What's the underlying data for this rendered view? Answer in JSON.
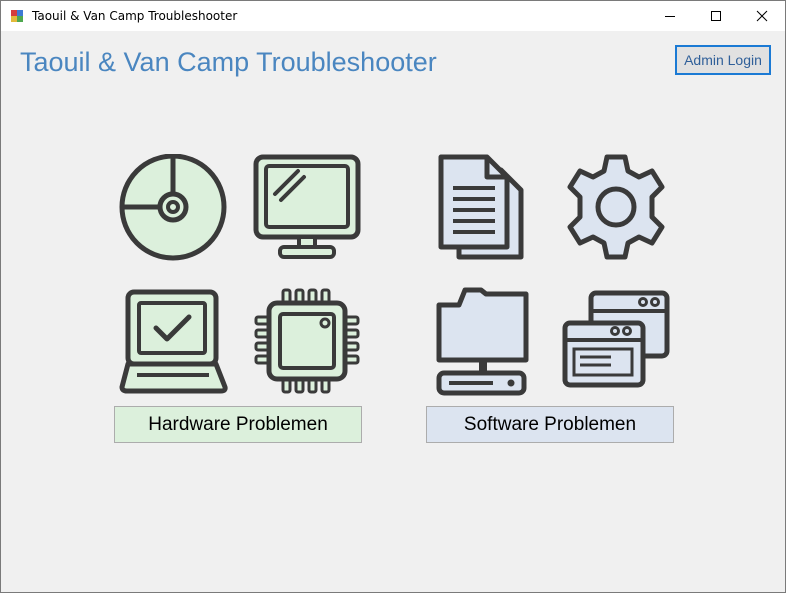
{
  "window": {
    "title": "Taouil & Van Camp Troubleshooter"
  },
  "header": {
    "title": "Taouil & Van Camp Troubleshooter",
    "admin_label": "Admin Login"
  },
  "hardware": {
    "label": "Hardware Problemen",
    "icons": [
      "cd-disc-icon",
      "monitor-icon",
      "laptop-check-icon",
      "cpu-chip-icon"
    ],
    "color": "#dcf0dc"
  },
  "software": {
    "label": "Software Problemen",
    "icons": [
      "documents-icon",
      "gear-icon",
      "network-folder-icon",
      "app-windows-icon"
    ],
    "color": "#dce4f0"
  },
  "colors": {
    "accent": "#4a86c0",
    "stroke": "#3a3a3a"
  }
}
